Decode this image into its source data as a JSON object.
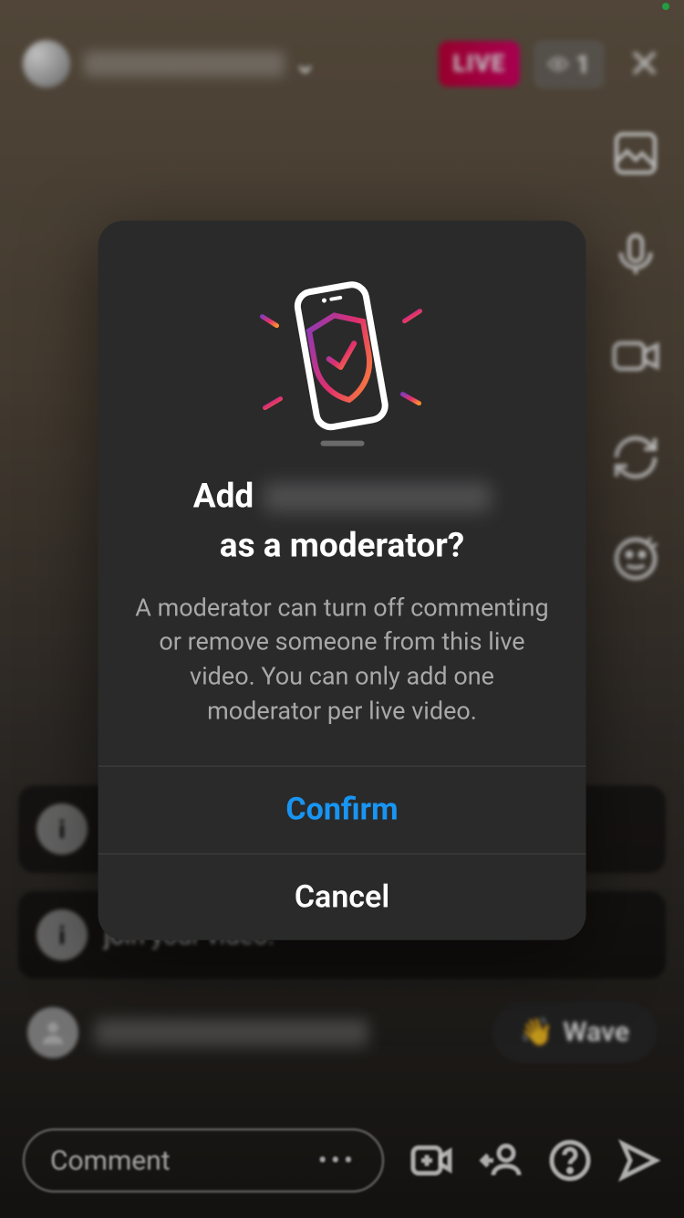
{
  "header": {
    "live_label": "LIVE",
    "viewer_count": "1"
  },
  "messages": {
    "partial_text": "join your video."
  },
  "user_row": {
    "wave_label": "Wave"
  },
  "bottom": {
    "comment_placeholder": "Comment"
  },
  "modal": {
    "title_prefix": "Add",
    "title_suffix": "as a moderator?",
    "description": "A moderator can turn off commenting or remove someone from this live video. You can only add one moderator per live video.",
    "confirm_label": "Confirm",
    "cancel_label": "Cancel"
  }
}
